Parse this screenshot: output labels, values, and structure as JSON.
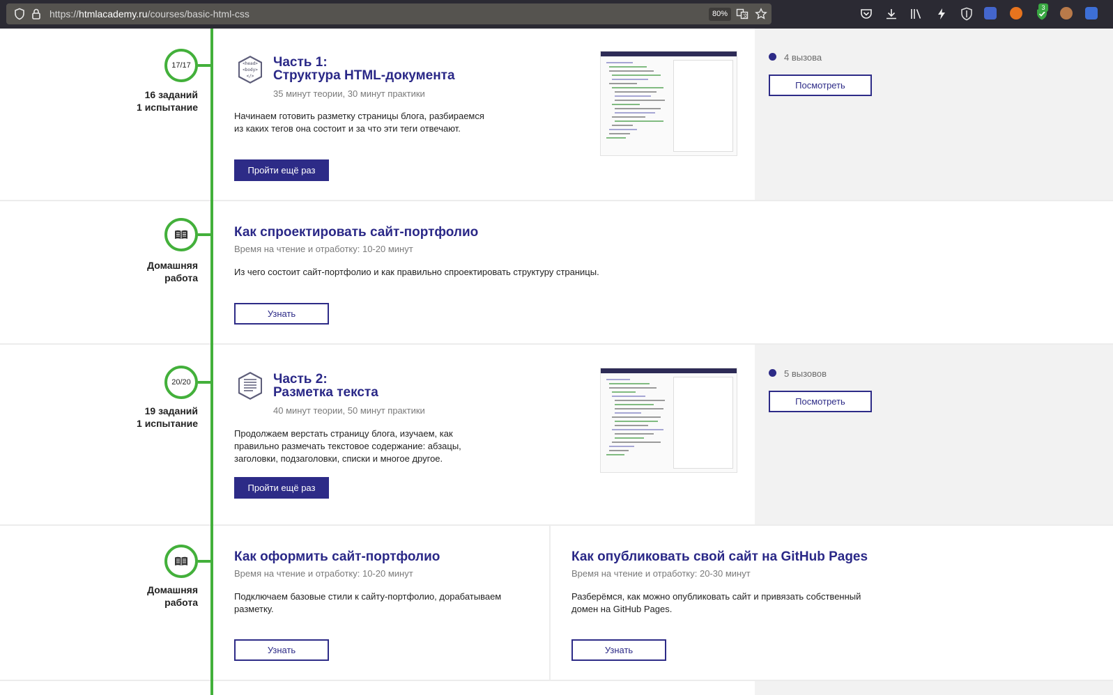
{
  "browser": {
    "url_prefix": "https://",
    "url_host": "htmlacademy.ru",
    "url_path": "/courses/basic-html-css",
    "zoom": "80%",
    "extension_badge": "3",
    "icons": [
      "shield-icon",
      "lock-icon",
      "translate-icon",
      "bookmark-star-icon",
      "pocket-icon",
      "download-icon",
      "library-icon",
      "flash-icon",
      "ublock-icon",
      "extension-icon",
      "fox-icon",
      "check-shield-icon",
      "avatar-icon",
      "translator-icon"
    ]
  },
  "parts": [
    {
      "progress": "17/17",
      "tasks": "16 заданий",
      "trials": "1 испытание",
      "title_line1": "Часть 1:",
      "title_line2": "Структура HTML-документа",
      "time": "35 минут теории, 30 минут практики",
      "description": "Начинаем готовить разметку страницы блога, разбираемся из каких тегов она состоит и за что эти теги отвечают.",
      "button": "Пройти ещё раз",
      "calls": "4 вызова",
      "view_button": "Посмотреть",
      "icon_tags": [
        "<head>",
        "<body>",
        "</>"
      ]
    },
    {
      "progress": "20/20",
      "tasks": "19 заданий",
      "trials": "1 испытание",
      "title_line1": "Часть 2:",
      "title_line2": "Разметка текста",
      "time": "40 минут теории, 50 минут практики",
      "description": "Продолжаем верстать страницу блога, изучаем, как правильно размечать текстовое содержание: абзацы, заголовки, подзаголовки, списки и многое другое.",
      "button": "Пройти ещё раз",
      "calls": "5 вызовов",
      "view_button": "Посмотреть"
    }
  ],
  "homeworks": [
    {
      "label_line1": "Домашняя",
      "label_line2": "работа",
      "title": "Как спроектировать сайт-портфолио",
      "time": "Время на чтение и отработку: 10-20 минут",
      "description": "Из чего состоит сайт-портфолио и как правильно спроектировать структуру страницы.",
      "button": "Узнать"
    },
    {
      "label_line1": "Домашняя",
      "label_line2": "работа",
      "title": "Как оформить сайт-портфолио",
      "time": "Время на чтение и отработку: 10-20 минут",
      "description": "Подключаем базовые стили к сайту-портфолио, дорабатываем разметку.",
      "button": "Узнать"
    },
    {
      "title": "Как опубликовать свой сайт на GitHub Pages",
      "time": "Время на чтение и отработку: 20-30 минут",
      "description": "Разберёмся, как можно опубликовать сайт и привязать собственный домен на GitHub Pages.",
      "button": "Узнать"
    }
  ],
  "colors": {
    "accent": "#2d2b87",
    "timeline": "#43b03b",
    "title": "#2a2887",
    "panel": "#f2f2f2"
  }
}
